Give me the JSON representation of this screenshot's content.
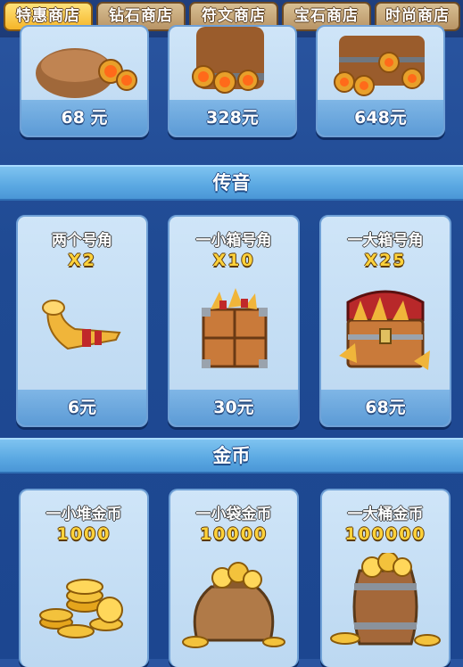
{
  "tabs": [
    {
      "label": "特惠商店",
      "active": true
    },
    {
      "label": "钻石商店",
      "active": false
    },
    {
      "label": "符文商店",
      "active": false
    },
    {
      "label": "宝石商店",
      "active": false
    },
    {
      "label": "时尚商店",
      "active": false
    }
  ],
  "top_row": {
    "items": [
      {
        "price": "68 元",
        "icon": "treasure-sack-icon"
      },
      {
        "price": "328元",
        "icon": "treasure-barrel-icon"
      },
      {
        "price": "648元",
        "icon": "treasure-chest-pile-icon"
      }
    ]
  },
  "sections": {
    "horn": {
      "title": "传音",
      "items": [
        {
          "name": "两个号角",
          "qty": "X2",
          "price": "6元",
          "icon": "horn-icon"
        },
        {
          "name": "一小箱号角",
          "qty": "X10",
          "price": "30元",
          "icon": "horn-crate-icon"
        },
        {
          "name": "一大箱号角",
          "qty": "X25",
          "price": "68元",
          "icon": "horn-chest-icon"
        }
      ]
    },
    "gold": {
      "title": "金币",
      "items": [
        {
          "name": "一小堆金币",
          "qty": "1000",
          "icon": "coin-pile-icon"
        },
        {
          "name": "一小袋金币",
          "qty": "10000",
          "icon": "coin-bag-icon"
        },
        {
          "name": "一大桶金币",
          "qty": "100000",
          "icon": "coin-barrel-icon"
        }
      ]
    }
  },
  "colors": {
    "active_tab": "#f5b528",
    "tab": "#c7a676",
    "card": "#cfe5f8",
    "section": "#5aa8e2"
  }
}
